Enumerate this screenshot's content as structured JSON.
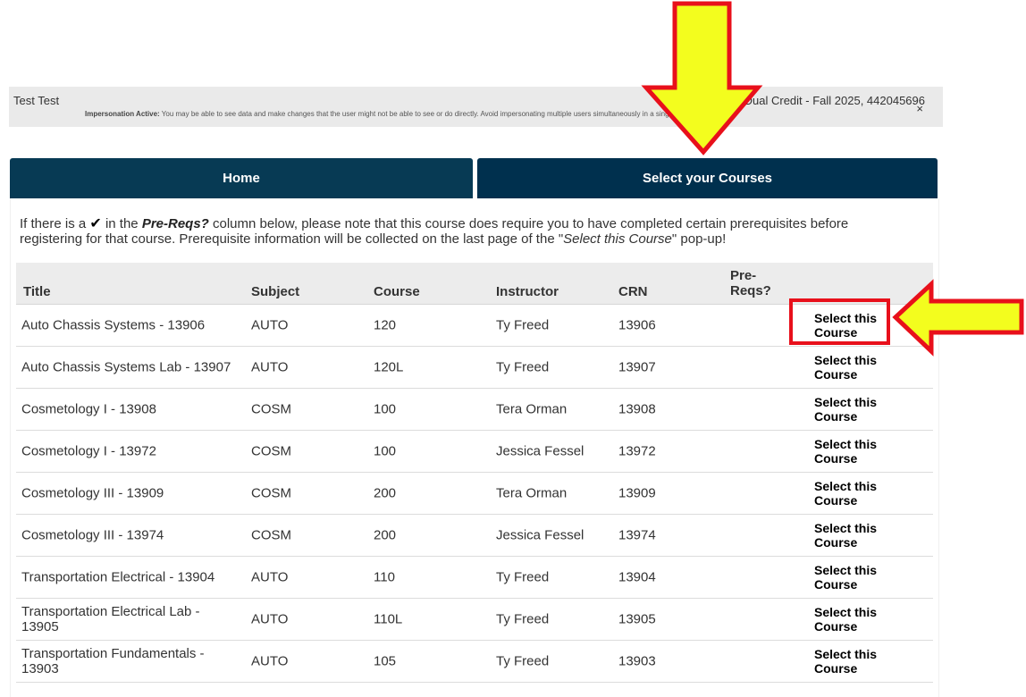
{
  "impersonation": {
    "user_name": "Test Test",
    "account": "VU Dual Credit - Fall 2025, 442045696",
    "note_label": "Impersonation Active:",
    "note_text": " You may be able to see data and make changes that the user might not be able to see or do directly. Avoid impersonating multiple users simultaneously in a single browser session.",
    "close": "×"
  },
  "tabs": {
    "home": "Home",
    "select": "Select your Courses"
  },
  "intro": {
    "part1": "If there is a ",
    "check": "✔",
    "part2": " in the ",
    "prereqs": "Pre-Reqs?",
    "part3": " column below, please note that this course does require you to have completed certain prerequisites before registering for that course. Prerequisite information will be collected on the last page of the \"",
    "select_label": "Select this Course",
    "part4": "\" pop-up!"
  },
  "table": {
    "headers": {
      "title": "Title",
      "subject": "Subject",
      "course": "Course",
      "instructor": "Instructor",
      "crn": "CRN",
      "prereqs": "Pre-\nReqs?"
    },
    "rows": [
      {
        "title": "Auto Chassis Systems - 13906",
        "subject": "AUTO",
        "course": "120",
        "instructor": "Ty Freed",
        "crn": "13906",
        "action": "Select this Course"
      },
      {
        "title": "Auto Chassis Systems Lab - 13907",
        "subject": "AUTO",
        "course": "120L",
        "instructor": "Ty Freed",
        "crn": "13907",
        "action": "Select this Course"
      },
      {
        "title": "Cosmetology I - 13908",
        "subject": "COSM",
        "course": "100",
        "instructor": "Tera Orman",
        "crn": "13908",
        "action": "Select this Course"
      },
      {
        "title": "Cosmetology I - 13972",
        "subject": "COSM",
        "course": "100",
        "instructor": "Jessica Fessel",
        "crn": "13972",
        "action": "Select this Course"
      },
      {
        "title": "Cosmetology III - 13909",
        "subject": "COSM",
        "course": "200",
        "instructor": "Tera Orman",
        "crn": "13909",
        "action": "Select this Course"
      },
      {
        "title": "Cosmetology III - 13974",
        "subject": "COSM",
        "course": "200",
        "instructor": "Jessica Fessel",
        "crn": "13974",
        "action": "Select this Course"
      },
      {
        "title": "Transportation Electrical - 13904",
        "subject": "AUTO",
        "course": "110",
        "instructor": "Ty Freed",
        "crn": "13904",
        "action": "Select this Course"
      },
      {
        "title": "Transportation Electrical Lab - 13905",
        "subject": "AUTO",
        "course": "110L",
        "instructor": "Ty Freed",
        "crn": "13905",
        "action": "Select this Course"
      },
      {
        "title": "Transportation Fundamentals - 13903",
        "subject": "AUTO",
        "course": "105",
        "instructor": "Ty Freed",
        "crn": "13903",
        "action": "Select this Course"
      }
    ]
  },
  "colors": {
    "tab_bg": "#073a54",
    "arrow_fill": "#f3fd1e",
    "arrow_stroke": "#e8101b"
  }
}
